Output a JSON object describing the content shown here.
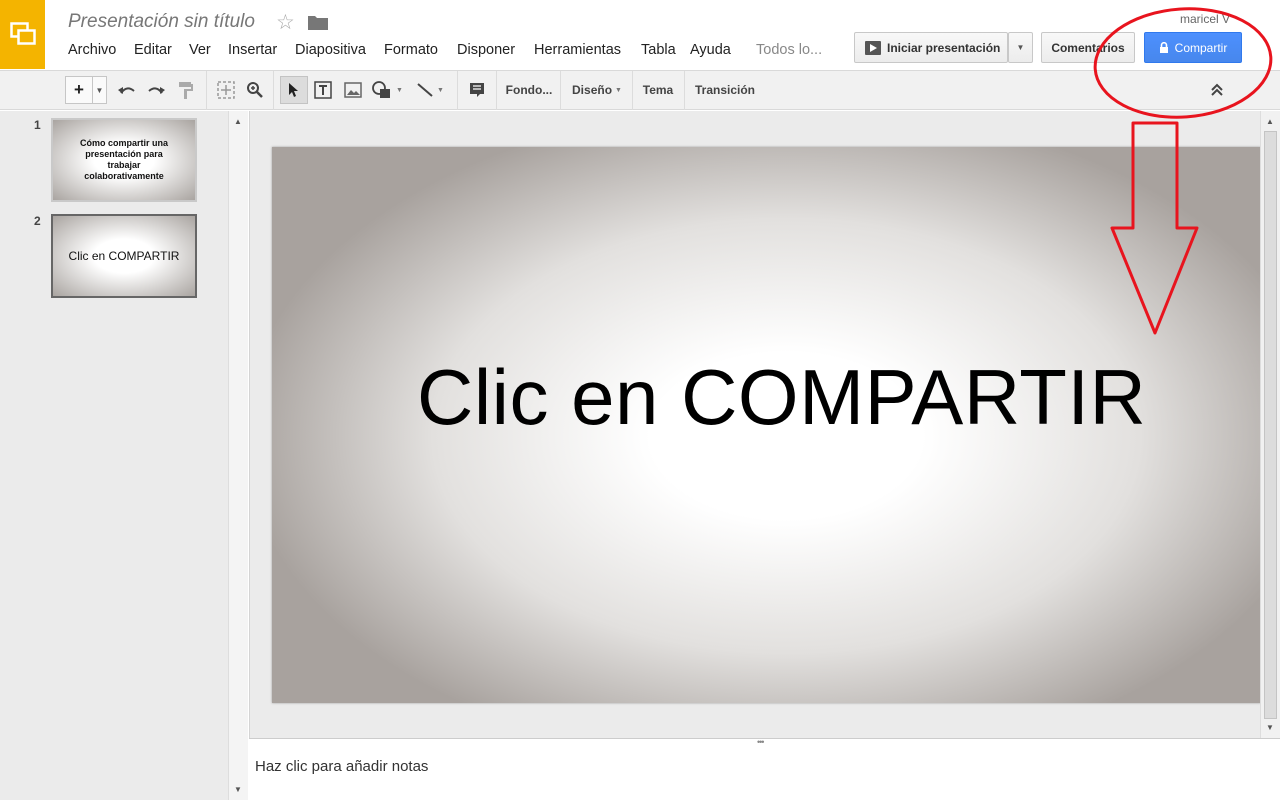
{
  "header": {
    "doc_title": "Presentación sin título",
    "user": "maricel V",
    "menu": [
      "Archivo",
      "Editar",
      "Ver",
      "Insertar",
      "Diapositiva",
      "Formato",
      "Disponer",
      "Herramientas",
      "Tabla",
      "Ayuda",
      "Todos lo..."
    ],
    "present_label": "Iniciar presentación",
    "comments_label": "Comentarios",
    "share_label": "Compartir",
    "share_color": "#4d90fe"
  },
  "toolbar": {
    "background_label": "Fondo...",
    "layout_label": "Diseño",
    "theme_label": "Tema",
    "transition_label": "Transición"
  },
  "slides": [
    {
      "number": "1",
      "title": "Cómo compartir una presentación para trabajar colaborativamente"
    },
    {
      "number": "2",
      "title": "Clic en COMPARTIR"
    }
  ],
  "canvas": {
    "title": "Clic en COMPARTIR"
  },
  "notes": {
    "placeholder": "Haz clic para añadir notas"
  },
  "annotation": {
    "color": "#e8141e"
  }
}
